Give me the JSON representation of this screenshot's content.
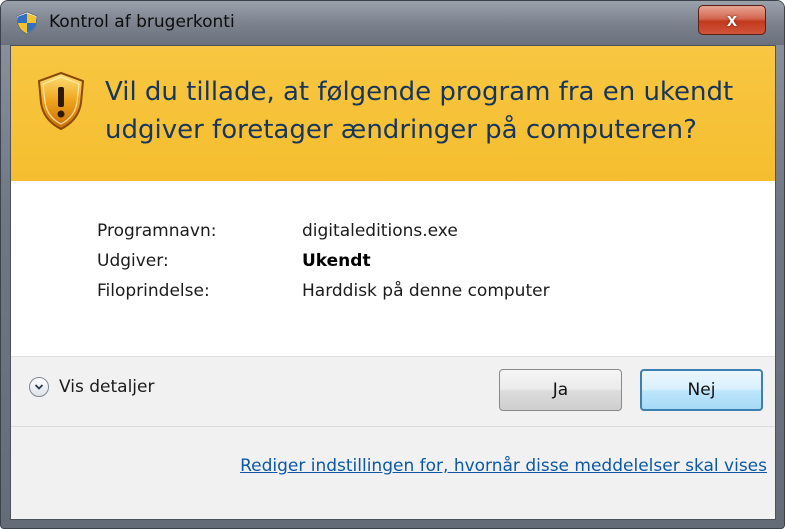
{
  "window": {
    "title": "Kontrol af brugerkonti",
    "close_label": "x"
  },
  "warning": {
    "message": "Vil du tillade, at følgende program fra en ukendt udgiver foretager ændringer på computeren?"
  },
  "details": {
    "rows": [
      {
        "label": "Programnavn:",
        "value": "digitaleditions.exe"
      },
      {
        "label": "Udgiver:",
        "value": "Ukendt"
      },
      {
        "label": "Filoprindelse:",
        "value": "Harddisk på denne computer"
      }
    ]
  },
  "actions": {
    "show_details_label": "Vis detaljer",
    "yes_label": "Ja",
    "no_label": "Nej"
  },
  "footer": {
    "settings_link": "Rediger indstillingen for, hvornår disse meddelelser skal vises"
  },
  "icons": {
    "title": "uac-shield-icon",
    "warning": "warning-shield-icon",
    "expander": "chevron-down-icon"
  },
  "colors": {
    "warning_band": "#f5be2f",
    "warning_text": "#17365e",
    "link": "#0c58a6",
    "close_button": "#c2391e"
  }
}
